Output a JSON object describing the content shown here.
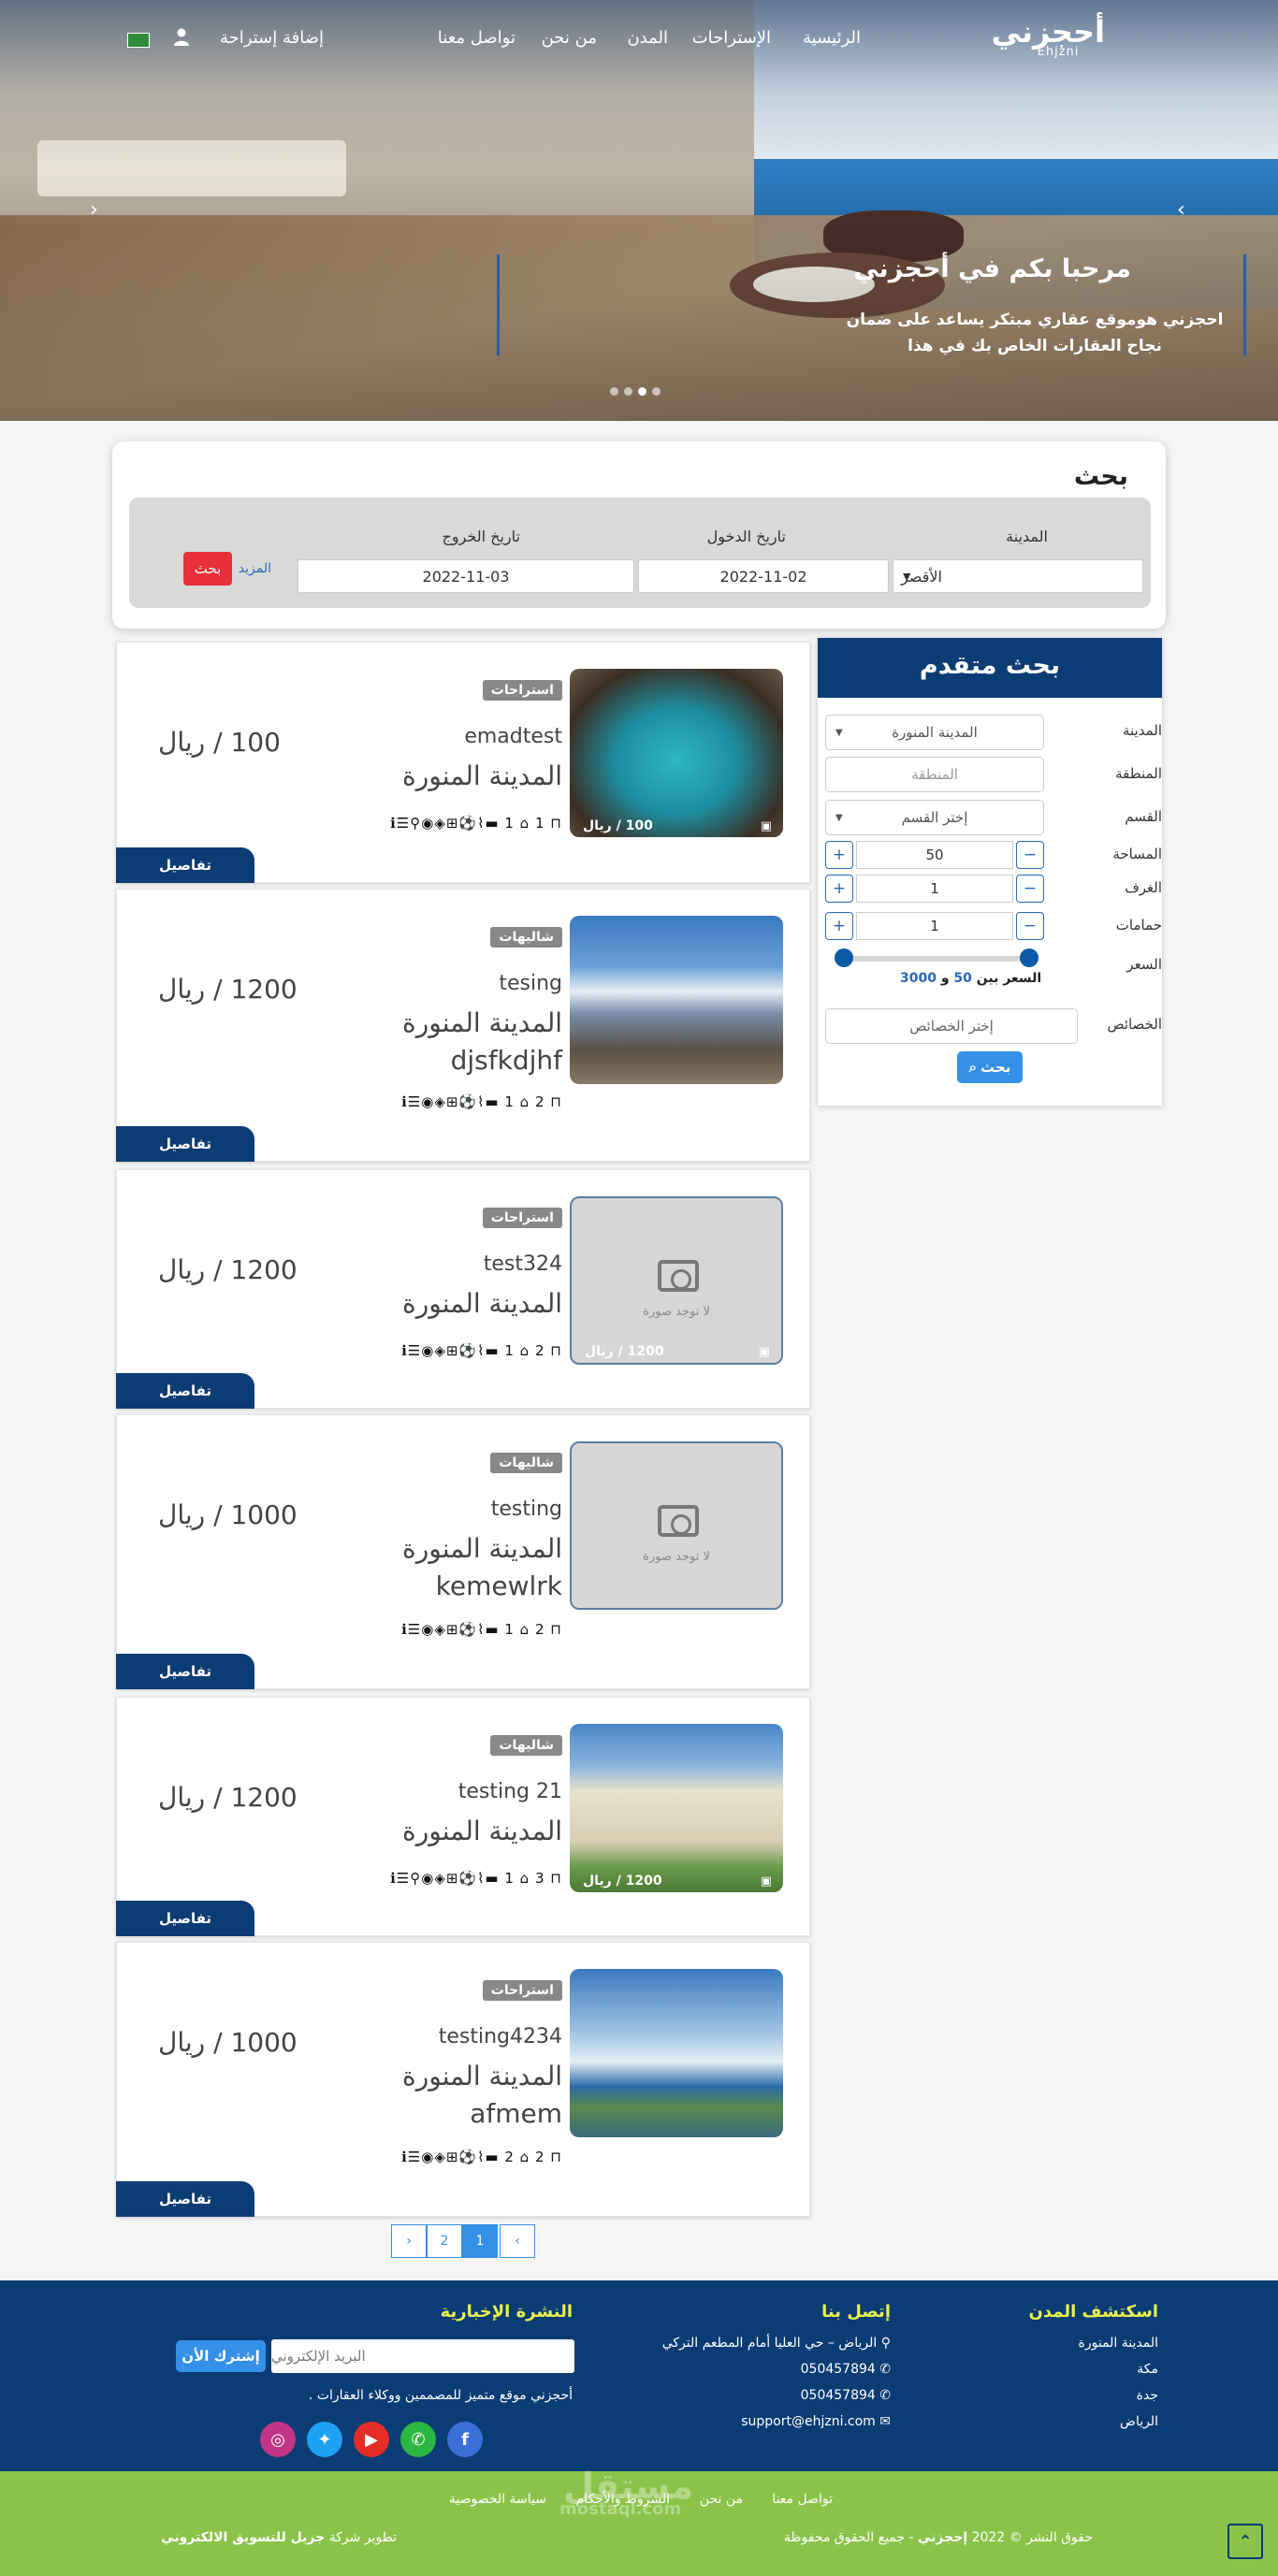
{
  "nav": {
    "logo_ar": "أحجزني",
    "logo_en": "Ehjzni",
    "links": [
      "الرئيسية",
      "الإستراحات",
      "المدن",
      "من نحن",
      "تواصل معنا"
    ],
    "add_rest": "إضافة إستراحة",
    "user_icon": "user-icon",
    "flag_icon": "saudi-flag-icon"
  },
  "hero": {
    "title": "مرحبا بكم في أحجزني",
    "text": "احجزني هوموقع عقاري مبتكر يساعد على ضمان نجاح العقارات الخاص بك في هذا",
    "slides": 4,
    "active_slide": 3
  },
  "search": {
    "title": "بحث",
    "city_label": "المدينة",
    "city_value": "الأقصر",
    "checkin_label": "تاريخ الدخول",
    "checkin_value": "2022-11-02",
    "checkout_label": "تاريخ الخروج",
    "checkout_value": "2022-11-03",
    "more": "المزيد",
    "button": "بحث"
  },
  "advanced": {
    "title": "بحث متقدم",
    "city_label": "المدينة",
    "city_value": "المدينة المنورة",
    "area_label": "المنطقة",
    "area_placeholder": "المنطقة",
    "section_label": "القسم",
    "section_value": "إختر القسم",
    "space_label": "المساحة",
    "space_value": "50",
    "rooms_label": "الغرف",
    "rooms_value": "1",
    "baths_label": "حمامات",
    "baths_value": "1",
    "price_label": "السعر",
    "price_text": "السعر بين",
    "price_min": "50",
    "price_and": "و",
    "price_max": "3000",
    "features_label": "الخصائص",
    "features_placeholder": "إختر الخصائص",
    "button": "بحث"
  },
  "listings": [
    {
      "badge": "استراحات",
      "name": "emadtest",
      "city": "المدينة المنورة",
      "extra": "",
      "price": "100 / ريال",
      "thumb_price": "100 / ريال",
      "amenities": "ℹ☰⚲◉◈⊞⚽⌇▬ 1 ⌂ 1 ⊓",
      "details": "تفاصيل",
      "image": "pool"
    },
    {
      "badge": "شاليهات",
      "name": "tesing",
      "city": "المدينة المنورة",
      "extra": "djsfkdjhf",
      "price": "1200 / ريال",
      "thumb_price": "",
      "amenities": "ℹ☰◉◈⊞⚽⌇▬ 1 ⌂ 2 ⊓",
      "details": "تفاصيل",
      "image": "mountain"
    },
    {
      "badge": "استراحات",
      "name": "test324",
      "city": "المدينة المنورة",
      "extra": "",
      "price": "1200 / ريال",
      "thumb_price": "1200 / ريال",
      "amenities": "ℹ☰◉◈⊞⚽⌇▬ 1 ⌂ 2 ⊓",
      "details": "تفاصيل",
      "image": "none",
      "no_image": "لا توجد صورة"
    },
    {
      "badge": "شاليهات",
      "name": "testing",
      "city": "المدينة المنورة",
      "extra": "kemewlrk",
      "price": "1000 / ريال",
      "thumb_price": "",
      "amenities": "ℹ☰◉◈⊞⚽⌇▬ 1 ⌂ 2 ⊓",
      "details": "تفاصيل",
      "image": "none",
      "no_image": "لا توجد صورة"
    },
    {
      "badge": "شاليهات",
      "name": "testing 21",
      "city": "المدينة المنورة",
      "extra": "",
      "price": "1200 / ريال",
      "thumb_price": "1200 / ريال",
      "amenities": "ℹ☰⚲◉◈⊞⚽⌇▬ 1 ⌂ 3 ⊓",
      "details": "تفاصيل",
      "image": "building"
    },
    {
      "badge": "استراحات",
      "name": "testing4234",
      "city": "المدينة المنورة",
      "extra": "afmem",
      "price": "1000 / ريال",
      "thumb_price": "",
      "amenities": "ℹ☰◉◈⊞⚽⌇▬ 2 ⌂ 2 ⊓",
      "details": "تفاصيل",
      "image": "coast"
    }
  ],
  "pagination": {
    "prev": "‹",
    "pages": [
      "1",
      "2"
    ],
    "active": "1",
    "next": "›"
  },
  "footer": {
    "cities_title": "اسكتشف المدن",
    "cities": [
      "المدينة المنورة",
      "مكة",
      "جدة",
      "الرياض"
    ],
    "contact_title": "إتصل بنا",
    "address": "الرياض – حي العليا أمام المطعم التركي",
    "phone1": "050457894",
    "phone2": "050457894",
    "email": "support@ehjzni.com",
    "newsletter_title": "النشرة الإخبارية",
    "newsletter_placeholder": "البريد الإلكتروني",
    "subscribe": "إشترك الأن",
    "about": "أحجزني موقع متميز للمصممين ووكلاء العقارات .",
    "social": [
      "facebook-icon",
      "whatsapp-icon",
      "youtube-icon",
      "twitter-icon",
      "instagram-icon"
    ]
  },
  "bottom": {
    "links": [
      "تواصل معنا",
      "من نحن",
      "الشروط والأحكام",
      "سياسة الخصوصية"
    ],
    "copyright_pre": "حقوق النشر © 2022",
    "copyright_brand": "إحجزني",
    "copyright_post": "- جميع الحقوق محفوظة",
    "dev_pre": "تطوير شركة",
    "dev_brand": "جزيل للتسويق الالكتروني",
    "watermark": "مستقل",
    "watermark_url": "mostaql.com"
  },
  "colors": {
    "primary": "#0c3c74",
    "accent": "#3590e8",
    "danger": "#e8303a",
    "green": "#8bc34a",
    "yellow": "#e8f24c"
  }
}
